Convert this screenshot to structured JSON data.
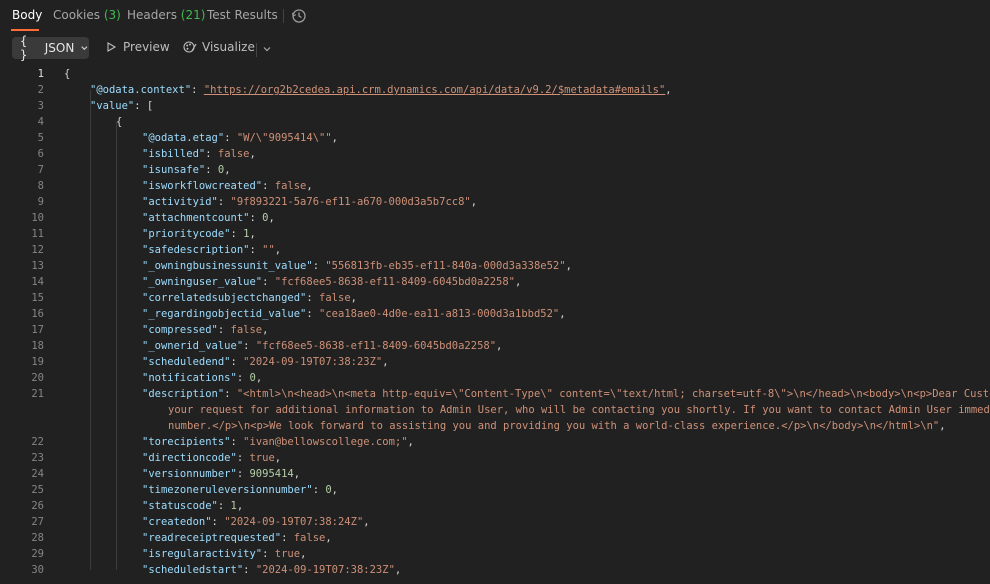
{
  "tabs": [
    {
      "label": "Body",
      "count": ""
    },
    {
      "label": "Cookies",
      "count": "(3)"
    },
    {
      "label": "Headers",
      "count": "(21)"
    },
    {
      "label": "Test Results",
      "count": ""
    }
  ],
  "toolbar": {
    "format_label": "JSON",
    "format_icon": "{ }",
    "preview_label": "Preview",
    "visualize_label": "Visualize"
  },
  "editor": {
    "line_numbers": [
      "1",
      "2",
      "3",
      "4",
      "5",
      "6",
      "7",
      "8",
      "9",
      "10",
      "11",
      "12",
      "13",
      "14",
      "15",
      "16",
      "17",
      "18",
      "19",
      "20",
      "21",
      "22",
      "23",
      "24",
      "25",
      "26",
      "27",
      "28",
      "29",
      "30"
    ],
    "lines": [
      {
        "ln": "1",
        "indent": 0,
        "tokens": [
          [
            "p",
            "{"
          ]
        ]
      },
      {
        "ln": "2",
        "indent": 1,
        "tokens": [
          [
            "k",
            "\"@odata.context\""
          ],
          [
            "p",
            ": "
          ],
          [
            "url",
            "\"https://org2b2cedea.api.crm.dynamics.com/api/data/v9.2/$metadata#emails\""
          ],
          [
            "p",
            ","
          ]
        ]
      },
      {
        "ln": "3",
        "indent": 1,
        "tokens": [
          [
            "k",
            "\"value\""
          ],
          [
            "p",
            ": ["
          ]
        ]
      },
      {
        "ln": "4",
        "indent": 2,
        "tokens": [
          [
            "p",
            "{"
          ]
        ]
      },
      {
        "ln": "5",
        "indent": 3,
        "tokens": [
          [
            "k",
            "\"@odata.etag\""
          ],
          [
            "p",
            ": "
          ],
          [
            "s",
            "\"W/\\\"9095414\\\"\""
          ],
          [
            "p",
            ","
          ]
        ]
      },
      {
        "ln": "6",
        "indent": 3,
        "tokens": [
          [
            "k",
            "\"isbilled\""
          ],
          [
            "p",
            ": "
          ],
          [
            "b",
            "false"
          ],
          [
            "p",
            ","
          ]
        ]
      },
      {
        "ln": "7",
        "indent": 3,
        "tokens": [
          [
            "k",
            "\"isunsafe\""
          ],
          [
            "p",
            ": "
          ],
          [
            "n",
            "0"
          ],
          [
            "p",
            ","
          ]
        ]
      },
      {
        "ln": "8",
        "indent": 3,
        "tokens": [
          [
            "k",
            "\"isworkflowcreated\""
          ],
          [
            "p",
            ": "
          ],
          [
            "b",
            "false"
          ],
          [
            "p",
            ","
          ]
        ]
      },
      {
        "ln": "9",
        "indent": 3,
        "tokens": [
          [
            "k",
            "\"activityid\""
          ],
          [
            "p",
            ": "
          ],
          [
            "s",
            "\"9f893221-5a76-ef11-a670-000d3a5b7cc8\""
          ],
          [
            "p",
            ","
          ]
        ]
      },
      {
        "ln": "10",
        "indent": 3,
        "tokens": [
          [
            "k",
            "\"attachmentcount\""
          ],
          [
            "p",
            ": "
          ],
          [
            "n",
            "0"
          ],
          [
            "p",
            ","
          ]
        ]
      },
      {
        "ln": "11",
        "indent": 3,
        "tokens": [
          [
            "k",
            "\"prioritycode\""
          ],
          [
            "p",
            ": "
          ],
          [
            "n",
            "1"
          ],
          [
            "p",
            ","
          ]
        ]
      },
      {
        "ln": "12",
        "indent": 3,
        "tokens": [
          [
            "k",
            "\"safedescription\""
          ],
          [
            "p",
            ": "
          ],
          [
            "s",
            "\"\""
          ],
          [
            "p",
            ","
          ]
        ]
      },
      {
        "ln": "13",
        "indent": 3,
        "tokens": [
          [
            "k",
            "\"_owningbusinessunit_value\""
          ],
          [
            "p",
            ": "
          ],
          [
            "s",
            "\"556813fb-eb35-ef11-840a-000d3a338e52\""
          ],
          [
            "p",
            ","
          ]
        ]
      },
      {
        "ln": "14",
        "indent": 3,
        "tokens": [
          [
            "k",
            "\"_owninguser_value\""
          ],
          [
            "p",
            ": "
          ],
          [
            "s",
            "\"fcf68ee5-8638-ef11-8409-6045bd0a2258\""
          ],
          [
            "p",
            ","
          ]
        ]
      },
      {
        "ln": "15",
        "indent": 3,
        "tokens": [
          [
            "k",
            "\"correlatedsubjectchanged\""
          ],
          [
            "p",
            ": "
          ],
          [
            "b",
            "false"
          ],
          [
            "p",
            ","
          ]
        ]
      },
      {
        "ln": "16",
        "indent": 3,
        "tokens": [
          [
            "k",
            "\"_regardingobjectid_value\""
          ],
          [
            "p",
            ": "
          ],
          [
            "s",
            "\"cea18ae0-4d0e-ea11-a813-000d3a1bbd52\""
          ],
          [
            "p",
            ","
          ]
        ]
      },
      {
        "ln": "17",
        "indent": 3,
        "tokens": [
          [
            "k",
            "\"compressed\""
          ],
          [
            "p",
            ": "
          ],
          [
            "b",
            "false"
          ],
          [
            "p",
            ","
          ]
        ]
      },
      {
        "ln": "18",
        "indent": 3,
        "tokens": [
          [
            "k",
            "\"_ownerid_value\""
          ],
          [
            "p",
            ": "
          ],
          [
            "s",
            "\"fcf68ee5-8638-ef11-8409-6045bd0a2258\""
          ],
          [
            "p",
            ","
          ]
        ]
      },
      {
        "ln": "19",
        "indent": 3,
        "tokens": [
          [
            "k",
            "\"scheduledend\""
          ],
          [
            "p",
            ": "
          ],
          [
            "s",
            "\"2024-09-19T07:38:23Z\""
          ],
          [
            "p",
            ","
          ]
        ]
      },
      {
        "ln": "20",
        "indent": 3,
        "tokens": [
          [
            "k",
            "\"notifications\""
          ],
          [
            "p",
            ": "
          ],
          [
            "n",
            "0"
          ],
          [
            "p",
            ","
          ]
        ]
      },
      {
        "ln": "21",
        "indent": 3,
        "tokens": [
          [
            "k",
            "\"description\""
          ],
          [
            "p",
            ": "
          ],
          [
            "s",
            "\"<html>\\n<head>\\n<meta http-equiv=\\\"Content-Type\\\" content=\\\"text/html; charset=utf-8\\\">\\n</head>\\n<body>\\n<p>Dear Customer, thank you for your email. We have forwarded"
          ]
        ]
      },
      {
        "ln": "",
        "indent": 4,
        "tokens": [
          [
            "s",
            "your request for additional information to Admin User, who will be contacting you shortly. If you want to contact Admin User immediately, please call"
          ]
        ]
      },
      {
        "ln": "",
        "indent": 4,
        "tokens": [
          [
            "s",
            "number.</p>\\n<p>We look forward to assisting you and providing you with a world-class experience.</p>\\n</body>\\n</html>\\n\""
          ],
          [
            "p",
            ","
          ]
        ]
      },
      {
        "ln": "22",
        "indent": 3,
        "tokens": [
          [
            "k",
            "\"torecipients\""
          ],
          [
            "p",
            ": "
          ],
          [
            "s",
            "\"ivan@bellowscollege.com;\""
          ],
          [
            "p",
            ","
          ]
        ]
      },
      {
        "ln": "23",
        "indent": 3,
        "tokens": [
          [
            "k",
            "\"directioncode\""
          ],
          [
            "p",
            ": "
          ],
          [
            "b",
            "true"
          ],
          [
            "p",
            ","
          ]
        ]
      },
      {
        "ln": "24",
        "indent": 3,
        "tokens": [
          [
            "k",
            "\"versionnumber\""
          ],
          [
            "p",
            ": "
          ],
          [
            "n",
            "9095414"
          ],
          [
            "p",
            ","
          ]
        ]
      },
      {
        "ln": "25",
        "indent": 3,
        "tokens": [
          [
            "k",
            "\"timezoneruleversionnumber\""
          ],
          [
            "p",
            ": "
          ],
          [
            "n",
            "0"
          ],
          [
            "p",
            ","
          ]
        ]
      },
      {
        "ln": "26",
        "indent": 3,
        "tokens": [
          [
            "k",
            "\"statuscode\""
          ],
          [
            "p",
            ": "
          ],
          [
            "n",
            "1"
          ],
          [
            "p",
            ","
          ]
        ]
      },
      {
        "ln": "27",
        "indent": 3,
        "tokens": [
          [
            "k",
            "\"createdon\""
          ],
          [
            "p",
            ": "
          ],
          [
            "s",
            "\"2024-09-19T07:38:24Z\""
          ],
          [
            "p",
            ","
          ]
        ]
      },
      {
        "ln": "28",
        "indent": 3,
        "tokens": [
          [
            "k",
            "\"readreceiptrequested\""
          ],
          [
            "p",
            ": "
          ],
          [
            "b",
            "false"
          ],
          [
            "p",
            ","
          ]
        ]
      },
      {
        "ln": "29",
        "indent": 3,
        "tokens": [
          [
            "k",
            "\"isregularactivity\""
          ],
          [
            "p",
            ": "
          ],
          [
            "b",
            "true"
          ],
          [
            "p",
            ","
          ]
        ]
      },
      {
        "ln": "30",
        "indent": 3,
        "tokens": [
          [
            "k",
            "\"scheduledstart\""
          ],
          [
            "p",
            ": "
          ],
          [
            "s",
            "\"2024-09-19T07:38:23Z\""
          ],
          [
            "p",
            ","
          ]
        ]
      }
    ]
  },
  "colors": {
    "accent": "#ff6c37",
    "key": "#9cdcfe",
    "string": "#ce9178",
    "number": "#b5cea8",
    "count": "#3fb950"
  }
}
